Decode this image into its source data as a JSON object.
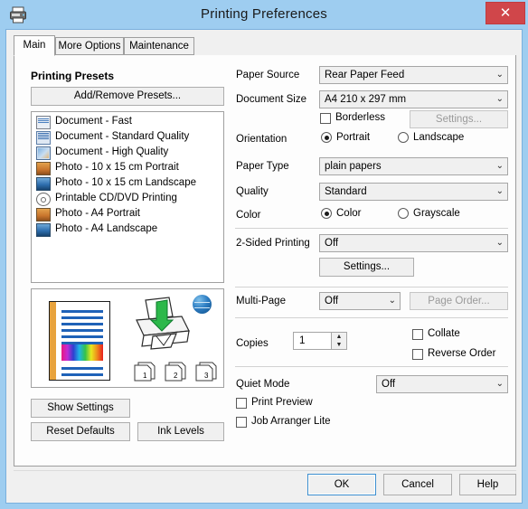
{
  "window": {
    "title": "Printing Preferences",
    "app_icon": "printer-icon",
    "close_label": "✕",
    "close_color": "#d0464a",
    "titlebar_color": "#9ecdf0"
  },
  "tabs": [
    {
      "label": "Main",
      "active": true
    },
    {
      "label": "More Options",
      "active": false
    },
    {
      "label": "Maintenance",
      "active": false
    }
  ],
  "presets": {
    "title": "Printing Presets",
    "add_remove_label": "Add/Remove Presets...",
    "items": [
      {
        "label": "Document - Fast",
        "icon": "document-icon"
      },
      {
        "label": "Document - Standard Quality",
        "icon": "document-icon"
      },
      {
        "label": "Document - High Quality",
        "icon": "document-hq-icon"
      },
      {
        "label": "Photo - 10 x 15 cm Portrait",
        "icon": "photo-portrait-icon"
      },
      {
        "label": "Photo - 10 x 15 cm Landscape",
        "icon": "photo-landscape-icon"
      },
      {
        "label": "Printable CD/DVD Printing",
        "icon": "cd-dvd-icon"
      },
      {
        "label": "Photo - A4 Portrait",
        "icon": "photo-portrait-icon"
      },
      {
        "label": "Photo - A4 Landscape",
        "icon": "photo-landscape-icon"
      }
    ]
  },
  "preview": {
    "document_icon": "document-preview-icon",
    "printer_icon": "printer-illustration-icon",
    "globe_icon": "globe-icon",
    "page_numbers": [
      "1",
      "2",
      "3"
    ]
  },
  "left_buttons": {
    "show_settings": "Show Settings",
    "reset_defaults": "Reset Defaults",
    "ink_levels": "Ink Levels"
  },
  "settings": {
    "paper_source": {
      "label": "Paper Source",
      "value": "Rear Paper Feed"
    },
    "document_size": {
      "label": "Document Size",
      "value": "A4 210 x 297 mm"
    },
    "borderless": {
      "label": "Borderless",
      "checked": false
    },
    "borderless_settings": {
      "label": "Settings...",
      "enabled": false
    },
    "orientation": {
      "label": "Orientation",
      "options": [
        {
          "label": "Portrait",
          "selected": true
        },
        {
          "label": "Landscape",
          "selected": false
        }
      ]
    },
    "paper_type": {
      "label": "Paper Type",
      "value": "plain papers"
    },
    "quality": {
      "label": "Quality",
      "value": "Standard"
    },
    "color": {
      "label": "Color",
      "options": [
        {
          "label": "Color",
          "selected": true
        },
        {
          "label": "Grayscale",
          "selected": false
        }
      ]
    },
    "two_sided": {
      "label": "2-Sided Printing",
      "value": "Off"
    },
    "two_sided_settings": {
      "label": "Settings...",
      "enabled": true
    },
    "multi_page": {
      "label": "Multi-Page",
      "value": "Off"
    },
    "page_order": {
      "label": "Page Order...",
      "enabled": false
    },
    "copies": {
      "label": "Copies",
      "value": "1"
    },
    "collate": {
      "label": "Collate",
      "checked": false
    },
    "reverse_order": {
      "label": "Reverse Order",
      "checked": false
    },
    "quiet_mode": {
      "label": "Quiet Mode",
      "value": "Off"
    },
    "print_preview": {
      "label": "Print Preview",
      "checked": false
    },
    "job_arranger": {
      "label": "Job Arranger Lite",
      "checked": false
    }
  },
  "footer": {
    "ok": "OK",
    "cancel": "Cancel",
    "help": "Help"
  },
  "icons": {
    "chevron_down": "⌄",
    "spin_up": "▲",
    "spin_down": "▼"
  }
}
